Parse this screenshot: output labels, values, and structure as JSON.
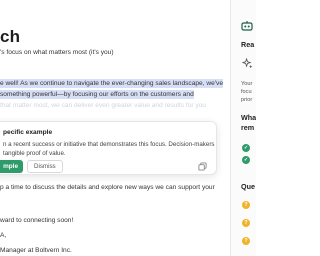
{
  "editor": {
    "title": "ch",
    "lines": [
      "'s focus on what matters most (it's you)",
      "e well! As we continue to navigate the ever-changing sales landscape, we've",
      "something powerful—by focusing our efforts on the customers and",
      "p a time to discuss the details and explore new ways we can support your",
      "ward to connecting soon!",
      "Manager at Boltvern Inc."
    ],
    "faded_fragment": "that matter most, we can deliver even greater value and results for you",
    "signoff_fragment": "A,"
  },
  "suggestion": {
    "title": "pecific example",
    "desc_line1": "n a recent success or initiative that demonstrates this focus. Decision-makers",
    "desc_line2": "tangible proof of value.",
    "apply_label": "mple",
    "dismiss_label": "Dismiss"
  },
  "sidebar": {
    "heading_top": "Rea",
    "text_lines": [
      "Your",
      "focu",
      "prior"
    ],
    "heading_mid1": "Wha",
    "heading_mid2": "rem",
    "heading_q": "Que",
    "colors": {
      "green": "#2f9a6a",
      "yellow": "#f0b429"
    }
  }
}
